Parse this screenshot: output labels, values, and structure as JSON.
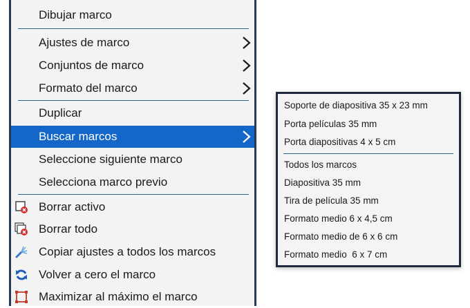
{
  "main_menu": {
    "items": [
      {
        "label": "Dibujar marco"
      },
      {
        "label": "Ajustes de marco"
      },
      {
        "label": "Conjuntos de marco"
      },
      {
        "label": "Formato del marco"
      },
      {
        "label": "Duplicar"
      },
      {
        "label": "Buscar marcos"
      },
      {
        "label": "Seleccione siguiente marco"
      },
      {
        "label": "Selecciona marco previo"
      },
      {
        "label": "Borrar activo",
        "icon": "delete-active-icon"
      },
      {
        "label": "Borrar todo",
        "icon": "delete-all-icon"
      },
      {
        "label": "Copiar ajustes a todos los marcos",
        "icon": "copy-settings-icon"
      },
      {
        "label": "Volver a cero el marco",
        "icon": "reset-icon"
      },
      {
        "label": "Maximizar al máximo el marco",
        "icon": "maximize-icon"
      }
    ],
    "selected_item": "Buscar marcos"
  },
  "submenu": {
    "items": [
      {
        "label": "Soporte de diapositiva 35 x 23 mm"
      },
      {
        "label": "Porta películas 35 mm"
      },
      {
        "label": "Porta diapositivas 4 x 5 cm"
      },
      {
        "label": "Todos los marcos"
      },
      {
        "label": "Diapositiva 35 mm"
      },
      {
        "label": "Tira de película 35 mm"
      },
      {
        "label": "Formato medio 6 x 4,5 cm"
      },
      {
        "label": "Formato medio de 6 x 6 cm"
      },
      {
        "label": "Formato medio  6 x 7 cm"
      }
    ]
  },
  "colors": {
    "selection": "#1467c8",
    "border": "#233a57",
    "separator": "#2d5f9a",
    "delete_badge": "#d32f2f"
  }
}
